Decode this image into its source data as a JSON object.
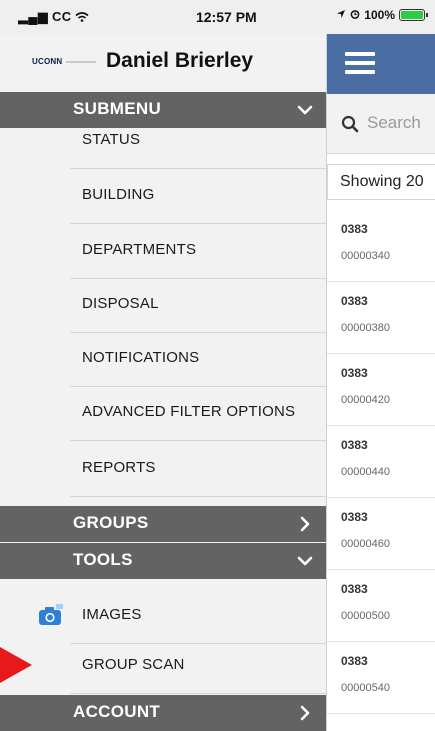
{
  "status_bar": {
    "carrier": "CC",
    "time": "12:57 PM",
    "battery": "100%",
    "battery_level": 1.0
  },
  "drawer": {
    "logo": "UCONN",
    "user_name": "Daniel Brierley",
    "sections": [
      {
        "label": "SUBMENU",
        "state": "expanded",
        "items": [
          "STATUS",
          "BUILDING",
          "DEPARTMENTS",
          "DISPOSAL",
          "NOTIFICATIONS",
          "ADVANCED FILTER OPTIONS",
          "REPORTS"
        ]
      },
      {
        "label": "GROUPS",
        "state": "collapsed",
        "items": []
      },
      {
        "label": "TOOLS",
        "state": "expanded",
        "items": [
          "IMAGES",
          "GROUP SCAN"
        ]
      },
      {
        "label": "ACCOUNT",
        "state": "collapsed",
        "items": []
      }
    ]
  },
  "background_app": {
    "search_placeholder": "Search",
    "showing_text": "Showing 20",
    "records": [
      {
        "code": "0383",
        "id": "00000340"
      },
      {
        "code": "0383",
        "id": "00000380"
      },
      {
        "code": "0383",
        "id": "00000420"
      },
      {
        "code": "0383",
        "id": "00000440"
      },
      {
        "code": "0383",
        "id": "00000460"
      },
      {
        "code": "0383",
        "id": "00000500"
      },
      {
        "code": "0383",
        "id": "00000540"
      }
    ]
  },
  "colors": {
    "header_blue": "#4a6ea4",
    "section_gray": "#636363",
    "drawer_bg": "#f2f2f2",
    "arrow_red": "#e8191c"
  }
}
